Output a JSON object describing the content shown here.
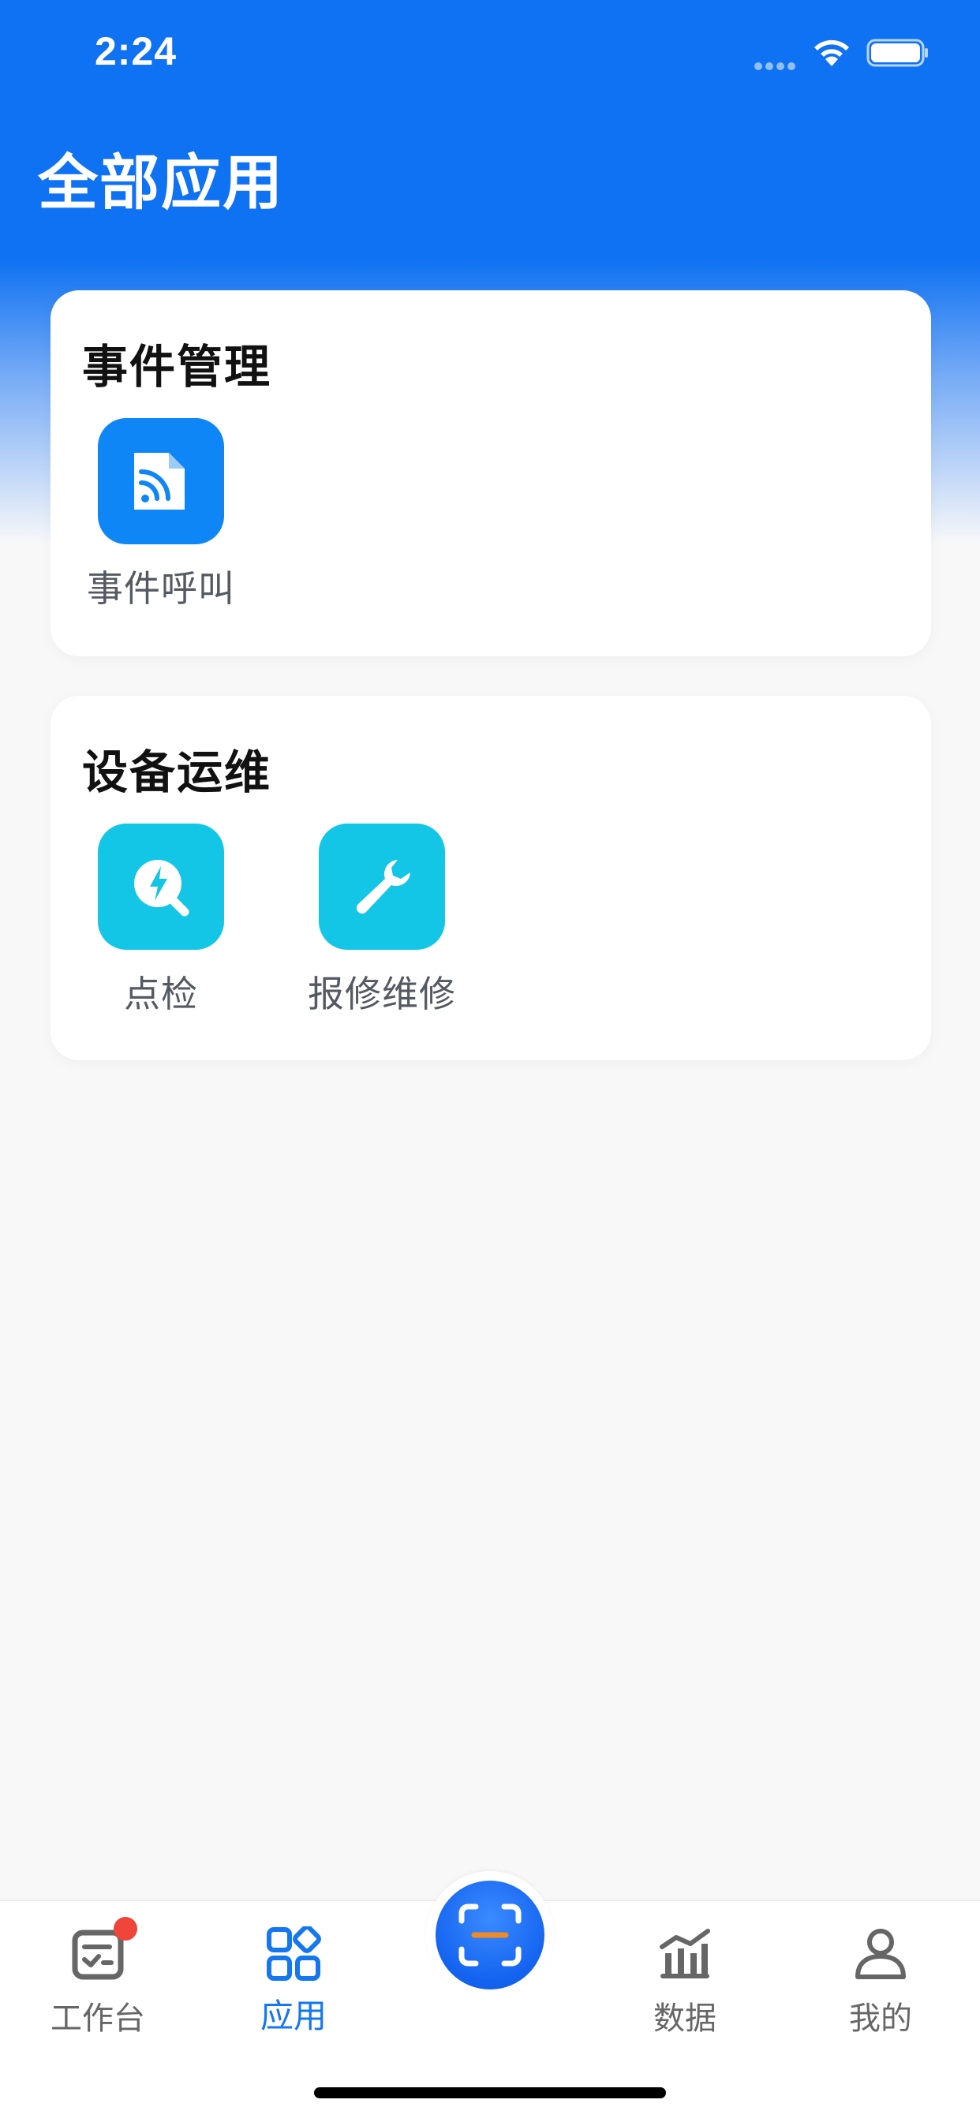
{
  "status_bar": {
    "time": "2:24"
  },
  "header": {
    "title": "全部应用"
  },
  "sections": [
    {
      "title": "事件管理",
      "apps": [
        {
          "label": "事件呼叫",
          "icon": "rss-document-icon",
          "color": "#0f86f5"
        }
      ]
    },
    {
      "title": "设备运维",
      "apps": [
        {
          "label": "点检",
          "icon": "lightning-search-icon",
          "color": "#13c6e6"
        },
        {
          "label": "报修维修",
          "icon": "wrench-icon",
          "color": "#13c6e6"
        }
      ]
    }
  ],
  "tab_bar": {
    "tabs": [
      {
        "label": "工作台",
        "icon": "clipboard-check-icon",
        "active": false,
        "badge": true
      },
      {
        "label": "应用",
        "icon": "apps-grid-icon",
        "active": true
      },
      {
        "label": "数据",
        "icon": "bar-chart-icon",
        "active": false
      },
      {
        "label": "我的",
        "icon": "user-icon",
        "active": false
      }
    ],
    "center_button": {
      "icon": "scan-icon"
    }
  },
  "colors": {
    "header_blue": "#0f72f2",
    "active_tab": "#1477ee",
    "badge_red": "#f0453a",
    "scan_accent": "#f08a24"
  }
}
